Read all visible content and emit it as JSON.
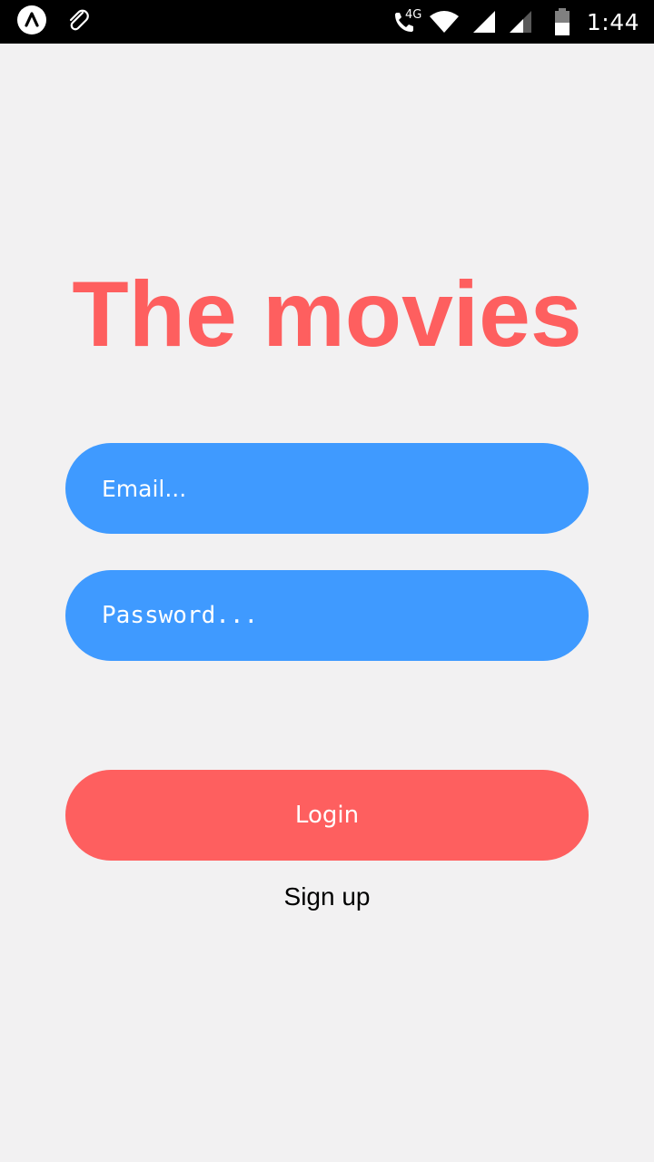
{
  "status_bar": {
    "time": "1:44",
    "network": "4G",
    "icons": [
      "app-launcher-icon",
      "paperclip-icon",
      "wifi-call-icon",
      "wifi-icon",
      "signal-icon",
      "signal-icon-2",
      "battery-icon"
    ]
  },
  "app": {
    "title": "The movies"
  },
  "form": {
    "email_placeholder": "Email...",
    "password_placeholder": "Password...",
    "login_label": "Login",
    "signup_label": "Sign up"
  },
  "colors": {
    "accent": "#fe5f5f",
    "input": "#3f9aff",
    "background": "#f2f1f2"
  }
}
